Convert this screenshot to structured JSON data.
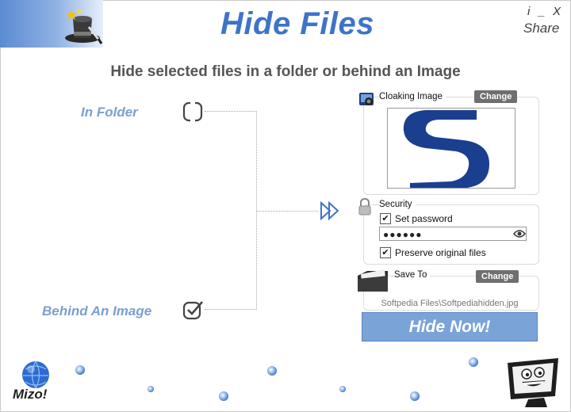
{
  "app": {
    "title": "Hide Files",
    "subtitle": "Hide selected files in a folder or behind an Image",
    "controls": {
      "info": "i",
      "minimize": "_",
      "close": "X",
      "share": "Share"
    }
  },
  "options": {
    "in_folder": {
      "label": "In Folder",
      "checked": false
    },
    "behind_image": {
      "label": "Behind An Image",
      "checked": true
    }
  },
  "cloaking": {
    "title": "Cloaking Image",
    "change_label": "Change"
  },
  "security": {
    "title": "Security",
    "set_password_label": "Set password",
    "set_password_checked": true,
    "check_mark": "✔",
    "password_value": "●●●●●●",
    "preserve_label": "Preserve original files",
    "preserve_checked": true
  },
  "save_to": {
    "title": "Save To",
    "change_label": "Change",
    "path": "Softpedia Files\\Softpediahidden.jpg"
  },
  "action": {
    "hide_now_label": "Hide Now!"
  },
  "brand": {
    "logo_text": "Mizo!"
  },
  "colors": {
    "accent": "#3e74c8",
    "button": "#7aa3d8",
    "label": "#7a9fcf"
  },
  "icons": [
    "magic-hat-icon",
    "cloaking-image-icon",
    "padlock-icon",
    "folder-icon",
    "fast-forward-icon",
    "globe-icon",
    "smiley-monitor-icon"
  ]
}
